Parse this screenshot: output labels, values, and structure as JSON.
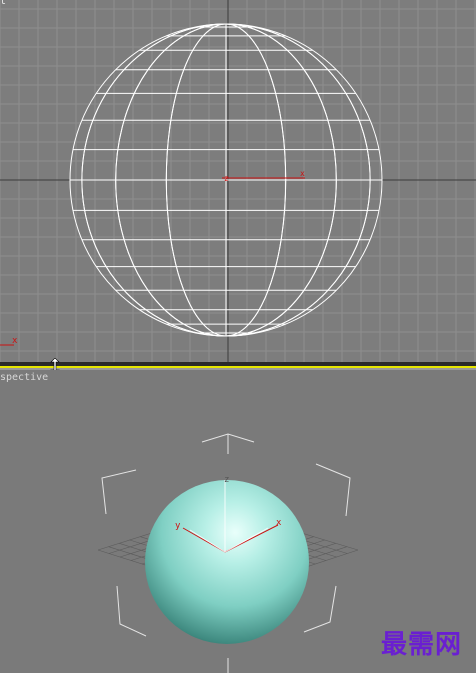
{
  "top_viewport": {
    "label": "Top",
    "label_visible": "t",
    "axis_label": "x"
  },
  "perspective_viewport": {
    "label": "Perspective",
    "label_visible": "spective",
    "axis_labels": [
      "z",
      "y",
      "x"
    ]
  },
  "watermark": "最需网",
  "colors": {
    "viewport_bg": "#7d7d7d",
    "grid": "#8c8c8c",
    "wireframe": "#ffffff",
    "axis_red": "#cc1111",
    "active_border": "#e6e600",
    "sphere": "#9fe0d6",
    "watermark": "#6a1fd1"
  }
}
